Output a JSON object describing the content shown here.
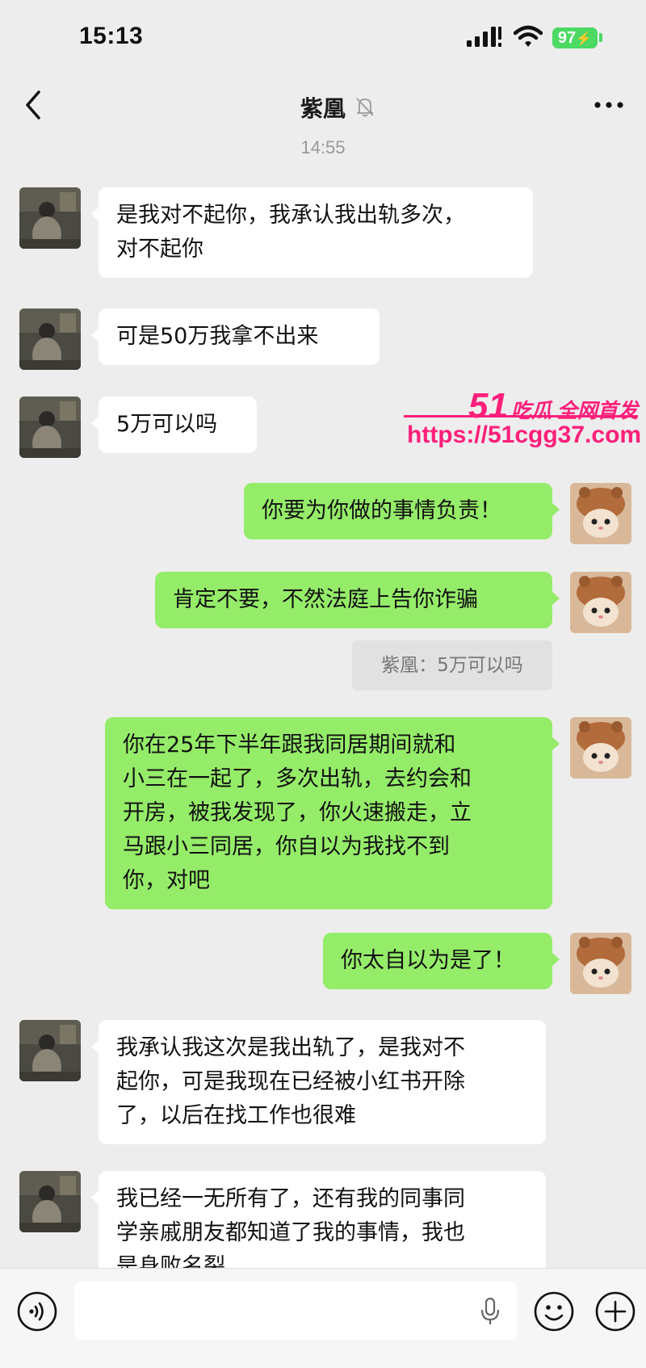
{
  "status_bar": {
    "time": "15:13",
    "battery": "97"
  },
  "header": {
    "title": "紫凰"
  },
  "timestamp": "14:55",
  "messages": [
    {
      "side": "left",
      "text": "是我对不起你，我承认我出轨多次，\n对不起你"
    },
    {
      "side": "left",
      "text": "可是50万我拿不出来"
    },
    {
      "side": "left",
      "text": "5万可以吗"
    },
    {
      "side": "right",
      "text": "你要为你做的事情负责！"
    },
    {
      "side": "right",
      "text": "肯定不要，不然法庭上告你诈骗"
    },
    {
      "side": "right",
      "text": "你在25年下半年跟我同居期间就和\n小三在一起了，多次出轨，去约会和\n开房，被我发现了，你火速搬走，立\n马跟小三同居，你自以为我找不到\n你，对吧"
    },
    {
      "side": "right",
      "text": "你太自以为是了！"
    },
    {
      "side": "left",
      "text": "我承认我这次是我出轨了，是我对不\n起你，可是我现在已经被小红书开除\n了，以后在找工作也很难"
    },
    {
      "side": "left",
      "text": "我已经一无所有了，还有我的同事同\n学亲戚朋友都知道了我的事情，我也\n是身败名裂"
    }
  ],
  "quote": "紫凰：5万可以吗",
  "watermark": {
    "brand_num": "51",
    "brand_text": "吃瓜 全网首发",
    "url": "https://51cgg37.com"
  },
  "input": {
    "value": ""
  },
  "icons": {
    "back": "chevron-left-icon",
    "mute": "bell-muted-icon",
    "more": "more-dots-icon",
    "voice": "voice-icon",
    "mic": "microphone-icon",
    "emoji": "emoji-icon",
    "plus": "plus-icon"
  },
  "colors": {
    "background": "#ededed",
    "incoming_bubble": "#ffffff",
    "outgoing_bubble": "#95ec69",
    "watermark": "#ff1f7a",
    "battery": "#4cd964"
  }
}
